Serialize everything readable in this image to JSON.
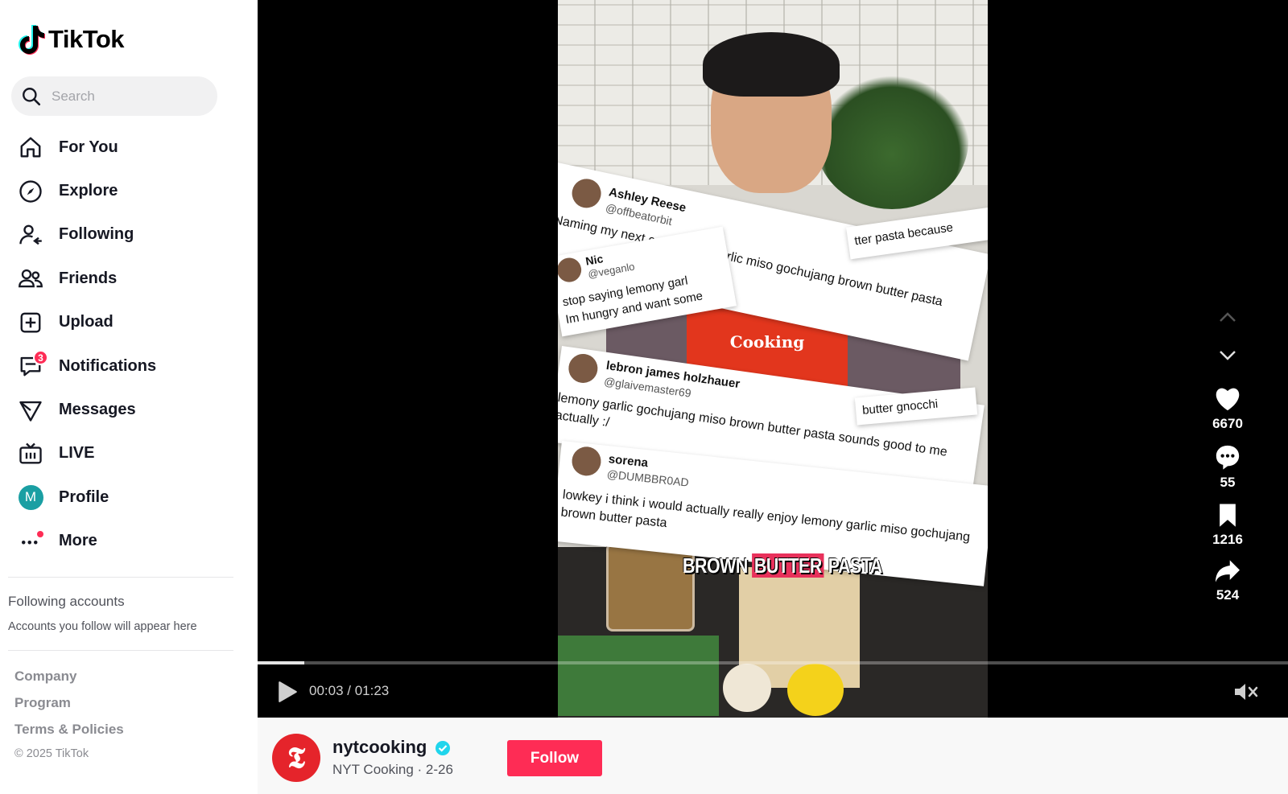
{
  "app": {
    "name": "TikTok"
  },
  "search": {
    "placeholder": "Search"
  },
  "nav": [
    {
      "label": "For You",
      "icon": "home-icon"
    },
    {
      "label": "Explore",
      "icon": "compass-icon"
    },
    {
      "label": "Following",
      "icon": "following-icon"
    },
    {
      "label": "Friends",
      "icon": "friends-icon"
    },
    {
      "label": "Upload",
      "icon": "upload-icon"
    },
    {
      "label": "Notifications",
      "icon": "notifications-icon",
      "badge": "3"
    },
    {
      "label": "Messages",
      "icon": "send-icon"
    },
    {
      "label": "LIVE",
      "icon": "live-icon"
    },
    {
      "label": "Profile",
      "icon": "avatar",
      "avatar_letter": "M"
    },
    {
      "label": "More",
      "icon": "more-icon"
    }
  ],
  "following_section": {
    "title": "Following accounts",
    "subtitle": "Accounts you follow will appear here"
  },
  "footer": {
    "links": [
      "Company",
      "Program",
      "Terms & Policies"
    ],
    "copyright": "© 2025 TikTok"
  },
  "video": {
    "time_current": "00:03",
    "time_total": "01:23",
    "progress": 0.045,
    "caption_part1": "BROWN",
    "caption_part2": "BUTTER",
    "caption_part3": "PASTA",
    "apron_text": "Cooking",
    "tweets": [
      {
        "name": "Ashley Reese",
        "handle": "@offbeatorbit",
        "body": "Naming my next cat lemony garlic miso gochujang brown butter pasta",
        "tail": "tter pasta because"
      },
      {
        "name": "Nic",
        "handle": "@veganlo",
        "body1": "stop saying lemony garl",
        "body2": "Im hungry and want some"
      },
      {
        "name": "lebron james holzhauer",
        "handle": "@glaivemaster69",
        "body1": "lemony garlic gochujang miso brown butter pasta sounds good to me",
        "body2": "actually :/",
        "tail": "butter gnocchi"
      },
      {
        "name": "sorena",
        "handle": "@DUMBBR0AD",
        "body1": "lowkey i think i would actually really enjoy lemony garlic miso gochujang",
        "body2": "brown butter pasta"
      }
    ]
  },
  "actions": {
    "likes": "6670",
    "comments": "55",
    "saves": "1216",
    "shares": "524"
  },
  "author": {
    "username": "nytcooking",
    "display_name": "NYT Cooking",
    "date": "2-26",
    "subtitle": "NYT Cooking · 2-26",
    "avatar_letter": "𝕿",
    "follow_label": "Follow"
  },
  "colors": {
    "accent": "#fe2c55",
    "verified": "#20d5ec",
    "profile_avatar": "#1a9fa3"
  }
}
